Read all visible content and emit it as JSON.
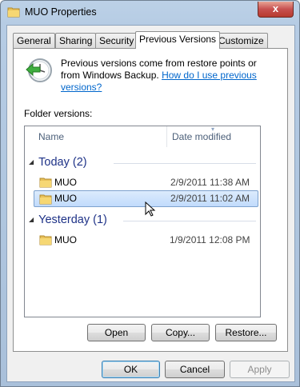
{
  "window": {
    "title": "MUO Properties",
    "close_symbol": "x"
  },
  "tabs": [
    {
      "label": "General"
    },
    {
      "label": "Sharing"
    },
    {
      "label": "Security"
    },
    {
      "label": "Previous Versions"
    },
    {
      "label": "Customize"
    }
  ],
  "active_tab": "Previous Versions",
  "intro": {
    "text": "Previous versions come from restore points or from Windows Backup.",
    "link": "How do I use previous versions?"
  },
  "folder_versions": {
    "label": "Folder versions:",
    "columns": [
      "Name",
      "Date modified"
    ],
    "groups": [
      {
        "label": "Today (2)",
        "items": [
          {
            "name": "MUO",
            "date": "2/9/2011 11:38 AM",
            "selected": false
          },
          {
            "name": "MUO",
            "date": "2/9/2011 11:02 AM",
            "selected": true
          }
        ]
      },
      {
        "label": "Yesterday (1)",
        "items": [
          {
            "name": "MUO",
            "date": "1/9/2011 12:08 PM",
            "selected": false
          }
        ]
      }
    ]
  },
  "actions": {
    "open": "Open",
    "copy": "Copy...",
    "restore": "Restore..."
  },
  "dialog_buttons": {
    "ok": "OK",
    "cancel": "Cancel",
    "apply": "Apply"
  },
  "colors": {
    "link": "#0066cc",
    "group_header": "#1e3287",
    "selection": "#c1dbfc"
  }
}
